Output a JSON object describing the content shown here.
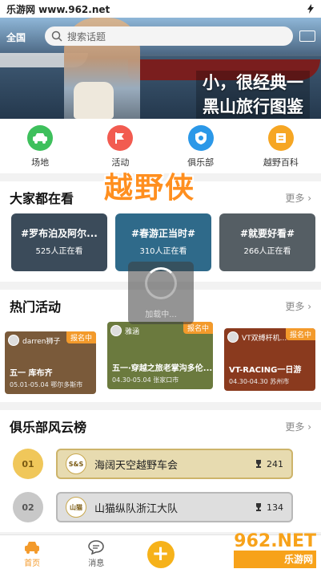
{
  "status_bar": {
    "site": "乐游网 www.962.net"
  },
  "header": {
    "city": "全国",
    "search_placeholder": "搜索话题"
  },
  "hero": {
    "line1": "小，很经典一",
    "line2": "黑山旅行图鉴"
  },
  "quick_nav": [
    {
      "label": "场地",
      "color": "#3ec05c",
      "icon": "car-icon"
    },
    {
      "label": "活动",
      "color": "#f25b50",
      "icon": "flag-icon"
    },
    {
      "label": "俱乐部",
      "color": "#2b98e8",
      "icon": "shield-icon"
    },
    {
      "label": "越野百科",
      "color": "#f6a623",
      "icon": "book-icon"
    }
  ],
  "brand": "越野侠",
  "watching": {
    "title": "大家都在看",
    "more": "更多 ›",
    "items": [
      {
        "tag": "#罗布泊及阿尔...",
        "count": "525人正在看",
        "color": "#3b4b5a"
      },
      {
        "tag": "#春游正当时#",
        "count": "310人正在看",
        "color": "#2f6a8a"
      },
      {
        "tag": "#就要好看#",
        "count": "266人正在看",
        "color": "#555e64"
      }
    ]
  },
  "events": {
    "title": "热门活动",
    "more": "更多 ›",
    "items": [
      {
        "org": "darren狮子",
        "badge": "报名中",
        "title": "五一 库布齐",
        "meta": "05.01-05.04 鄂尔多斯市",
        "color": "#7a5a3a"
      },
      {
        "org": "雅涵",
        "badge": "报名中",
        "title": "五一·穿越之旅老掌沟多伦...",
        "meta": "04.30-05.04 张家口市",
        "color": "#6b7a3e"
      },
      {
        "org": "VT双缚杆机...",
        "badge": "报名中",
        "title": "VT-RACING一日游",
        "meta": "04.30-04.30 苏州市",
        "color": "#8a3a1e"
      }
    ]
  },
  "loading": {
    "text": "加载中..."
  },
  "clubs": {
    "title": "俱乐部风云榜",
    "more": "更多 ›",
    "items": [
      {
        "rank": "01",
        "logo": "S&S",
        "name": "海阔天空越野车会",
        "score": "241",
        "medal_color": "#f0c75a",
        "plate_color": "#e7dbb0"
      },
      {
        "rank": "02",
        "logo": "山猫",
        "name": "山猫纵队浙江大队",
        "score": "134",
        "medal_color": "#c8c8c8",
        "plate_color": "#dedede"
      }
    ]
  },
  "tabbar": [
    {
      "label": "首页",
      "icon": "car-icon",
      "active": true
    },
    {
      "label": "消息",
      "icon": "chat-icon",
      "active": false
    },
    {
      "label": "",
      "icon": "plus-icon",
      "active": false
    },
    {
      "label": "",
      "icon": "",
      "active": false
    },
    {
      "label": "",
      "icon": "",
      "active": false
    }
  ],
  "watermark": {
    "main": "962.NET",
    "sub": "乐游网"
  }
}
